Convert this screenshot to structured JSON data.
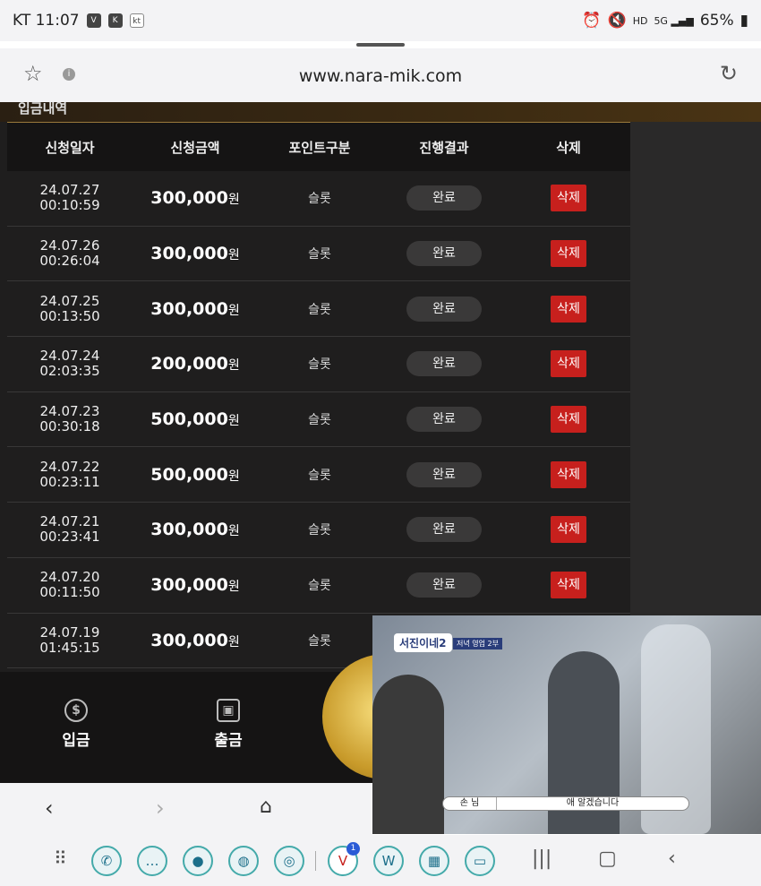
{
  "status_bar": {
    "carrier_time": "KT 11:07",
    "battery": "65%"
  },
  "browser": {
    "url": "www.nara-mik.com"
  },
  "page": {
    "section_title": "입금내역",
    "columns": [
      "신청일자",
      "신청금액",
      "포인트구분",
      "진행결과",
      "삭제"
    ],
    "currency_unit": "원",
    "rows": [
      {
        "date": "24.07.27",
        "time": "00:10:59",
        "amount": "300,000",
        "type": "슬롯",
        "status": "완료",
        "delete": "삭제"
      },
      {
        "date": "24.07.26",
        "time": "00:26:04",
        "amount": "300,000",
        "type": "슬롯",
        "status": "완료",
        "delete": "삭제"
      },
      {
        "date": "24.07.25",
        "time": "00:13:50",
        "amount": "300,000",
        "type": "슬롯",
        "status": "완료",
        "delete": "삭제"
      },
      {
        "date": "24.07.24",
        "time": "02:03:35",
        "amount": "200,000",
        "type": "슬롯",
        "status": "완료",
        "delete": "삭제"
      },
      {
        "date": "24.07.23",
        "time": "00:30:18",
        "amount": "500,000",
        "type": "슬롯",
        "status": "완료",
        "delete": "삭제"
      },
      {
        "date": "24.07.22",
        "time": "00:23:11",
        "amount": "500,000",
        "type": "슬롯",
        "status": "완료",
        "delete": "삭제"
      },
      {
        "date": "24.07.21",
        "time": "00:23:41",
        "amount": "300,000",
        "type": "슬롯",
        "status": "완료",
        "delete": "삭제"
      },
      {
        "date": "24.07.20",
        "time": "00:11:50",
        "amount": "300,000",
        "type": "슬롯",
        "status": "완료",
        "delete": "삭제"
      },
      {
        "date": "24.07.19",
        "time": "01:45:15",
        "amount": "300,000",
        "type": "슬롯",
        "status": "",
        "delete": ""
      }
    ],
    "bottom_nav": [
      {
        "label": "입금",
        "icon": "dollar-coin-icon"
      },
      {
        "label": "출금",
        "icon": "wallet-icon"
      }
    ]
  },
  "video_overlay": {
    "show_logo": "서진이네2",
    "tag": "저녁 영업 2부",
    "subtitle_speaker": "손 님",
    "subtitle_text": "애 알겠습니다"
  },
  "dock": {
    "badge_count": "1"
  },
  "colors": {
    "delete_red": "#c7201d",
    "gold_accent": "#9a7a3c",
    "page_dark": "#1f1e1e"
  }
}
